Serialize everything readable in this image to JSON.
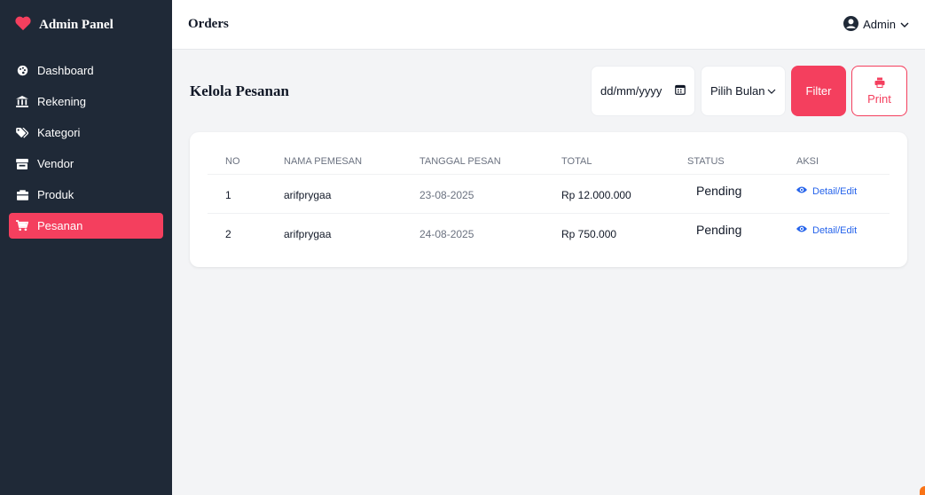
{
  "brand": {
    "title": "Admin Panel",
    "icon": "heart-icon",
    "icon_color": "#f43f5e"
  },
  "sidebar": {
    "items": [
      {
        "label": "Dashboard",
        "icon": "palette-icon"
      },
      {
        "label": "Rekening",
        "icon": "bank-icon"
      },
      {
        "label": "Kategori",
        "icon": "tags-icon"
      },
      {
        "label": "Vendor",
        "icon": "store-icon"
      },
      {
        "label": "Produk",
        "icon": "box-icon"
      },
      {
        "label": "Pesanan",
        "icon": "cart-icon",
        "active": true
      }
    ]
  },
  "topbar": {
    "title": "Orders",
    "user": "Admin"
  },
  "main": {
    "title": "Kelola Pesanan",
    "filters": {
      "date_placeholder": "dd/mm/yyyy",
      "month_select": "Pilih Bulan",
      "filter_label": "Filter",
      "print_label": "Print"
    }
  },
  "table": {
    "headers": [
      "NO",
      "NAMA PEMESAN",
      "TANGGAL PESAN",
      "TOTAL",
      "STATUS",
      "AKSI"
    ],
    "rows": [
      {
        "no": "1",
        "nama": "arifprygaa",
        "tanggal": "23-08-2025",
        "total": "Rp 12.000.000",
        "status": "Pending",
        "aksi": "Detail/Edit"
      },
      {
        "no": "2",
        "nama": "arifprygaa",
        "tanggal": "24-08-2025",
        "total": "Rp 750.000",
        "status": "Pending",
        "aksi": "Detail/Edit"
      }
    ]
  },
  "colors": {
    "sidebar_bg": "#1f2937",
    "accent": "#f43f5e",
    "link": "#2563eb"
  }
}
